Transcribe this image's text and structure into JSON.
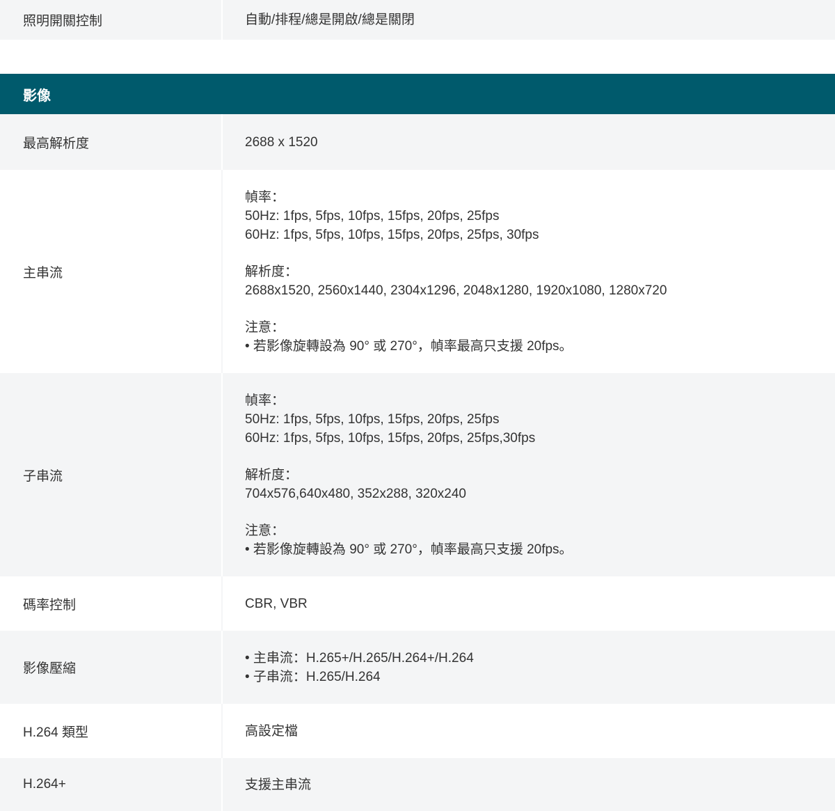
{
  "top_row": {
    "label": "照明開關控制",
    "value": "自動/排程/總是開啟/總是關閉"
  },
  "section": {
    "title": "影像"
  },
  "rows": {
    "max_resolution": {
      "label": "最高解析度",
      "value": "2688 x 1520"
    },
    "main_stream": {
      "label": "主串流",
      "framerate_title": "幀率：",
      "framerate_50": "50Hz: 1fps, 5fps, 10fps, 15fps, 20fps, 25fps",
      "framerate_60": "60Hz: 1fps, 5fps, 10fps, 15fps, 20fps, 25fps, 30fps",
      "resolution_title": "解析度：",
      "resolution_values": "2688x1520, 2560x1440, 2304x1296, 2048x1280, 1920x1080, 1280x720",
      "note_title": "注意：",
      "note_text": "• 若影像旋轉設為 90° 或 270°，幀率最高只支援 20fps。"
    },
    "sub_stream": {
      "label": "子串流",
      "framerate_title": "幀率：",
      "framerate_50": "50Hz: 1fps, 5fps, 10fps, 15fps, 20fps, 25fps",
      "framerate_60": "60Hz: 1fps, 5fps, 10fps, 15fps, 20fps, 25fps,30fps",
      "resolution_title": "解析度：",
      "resolution_values": "704x576,640x480, 352x288, 320x240",
      "note_title": "注意：",
      "note_text": "• 若影像旋轉設為 90° 或 270°，幀率最高只支援 20fps。"
    },
    "bitrate_control": {
      "label": "碼率控制",
      "value": "CBR, VBR"
    },
    "compression": {
      "label": "影像壓縮",
      "line1": "• 主串流：H.265+/H.265/H.264+/H.264",
      "line2": "• 子串流：H.265/H.264"
    },
    "h264_type": {
      "label": "H.264 類型",
      "value": "高設定檔"
    },
    "h264_plus": {
      "label": "H.264+",
      "value": "支援主串流"
    }
  },
  "colors": {
    "header_bg": "#005a6c",
    "row_gray": "#f4f5f6",
    "text": "#333333"
  }
}
